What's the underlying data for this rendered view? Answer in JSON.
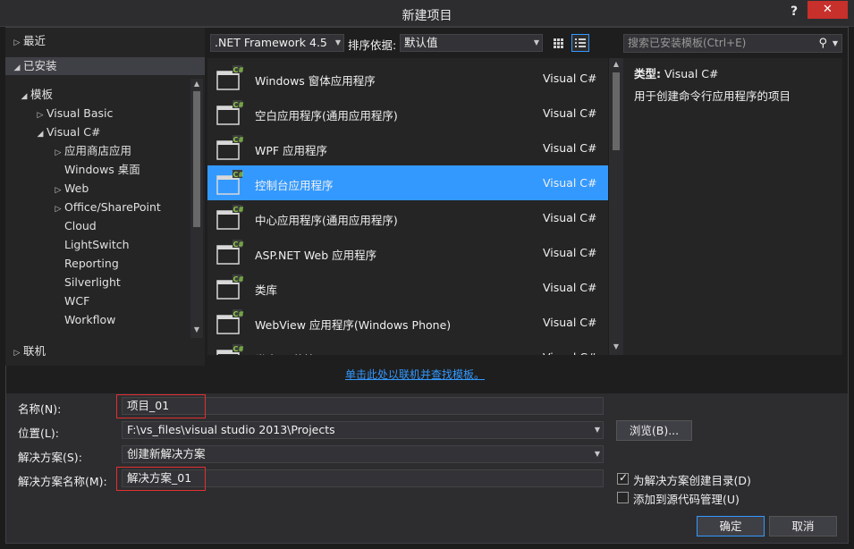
{
  "window": {
    "title": "新建项目",
    "help": "?",
    "close": "✕"
  },
  "tree": {
    "recent": "最近",
    "installed": "已安装",
    "templates": "模板",
    "visual_basic": "Visual Basic",
    "visual_csharp": "Visual C#",
    "children": [
      "应用商店应用",
      "Windows 桌面",
      "Web",
      "Office/SharePoint",
      "Cloud",
      "LightSwitch",
      "Reporting",
      "Silverlight",
      "WCF",
      "Workflow"
    ],
    "online": "联机"
  },
  "toolbar": {
    "framework": ".NET Framework 4.5",
    "sort_label": "排序依据:",
    "sort_value": "默认值",
    "search_placeholder": "搜索已安装模板(Ctrl+E)"
  },
  "templates": [
    {
      "name": "Windows 窗体应用程序",
      "lang": "Visual C#",
      "icon": "winforms-icon"
    },
    {
      "name": "空白应用程序(通用应用程序)",
      "lang": "Visual C#",
      "icon": "blank-app-icon"
    },
    {
      "name": "WPF 应用程序",
      "lang": "Visual C#",
      "icon": "wpf-icon"
    },
    {
      "name": "控制台应用程序",
      "lang": "Visual C#",
      "icon": "console-icon"
    },
    {
      "name": "中心应用程序(通用应用程序)",
      "lang": "Visual C#",
      "icon": "hub-app-icon"
    },
    {
      "name": "ASP.NET Web 应用程序",
      "lang": "Visual C#",
      "icon": "web-app-icon"
    },
    {
      "name": "类库",
      "lang": "Visual C#",
      "icon": "class-library-icon"
    },
    {
      "name": "WebView 应用程序(Windows Phone)",
      "lang": "Visual C#",
      "icon": "webview-icon"
    },
    {
      "name": "类库(可移植)",
      "lang": "Visual C#",
      "icon": "portable-library-icon"
    }
  ],
  "selected_template_index": 3,
  "info": {
    "type_label": "类型:",
    "type_value": "Visual C#",
    "description": "用于创建命令行应用程序的项目"
  },
  "online_link": "单击此处以联机并查找模板。",
  "form": {
    "name_label": "名称(N):",
    "name_value": "项目_01",
    "location_label": "位置(L):",
    "location_value": "F:\\vs_files\\visual studio 2013\\Projects",
    "browse_button": "浏览(B)...",
    "solution_label": "解决方案(S):",
    "solution_value": "创建新解决方案",
    "solution_name_label": "解决方案名称(M):",
    "solution_name_value": "解决方案_01",
    "create_dir_label": "为解决方案创建目录(D)",
    "create_dir_checked": true,
    "source_control_label": "添加到源代码管理(U)",
    "source_control_checked": false,
    "ok_button": "确定",
    "cancel_button": "取消"
  }
}
